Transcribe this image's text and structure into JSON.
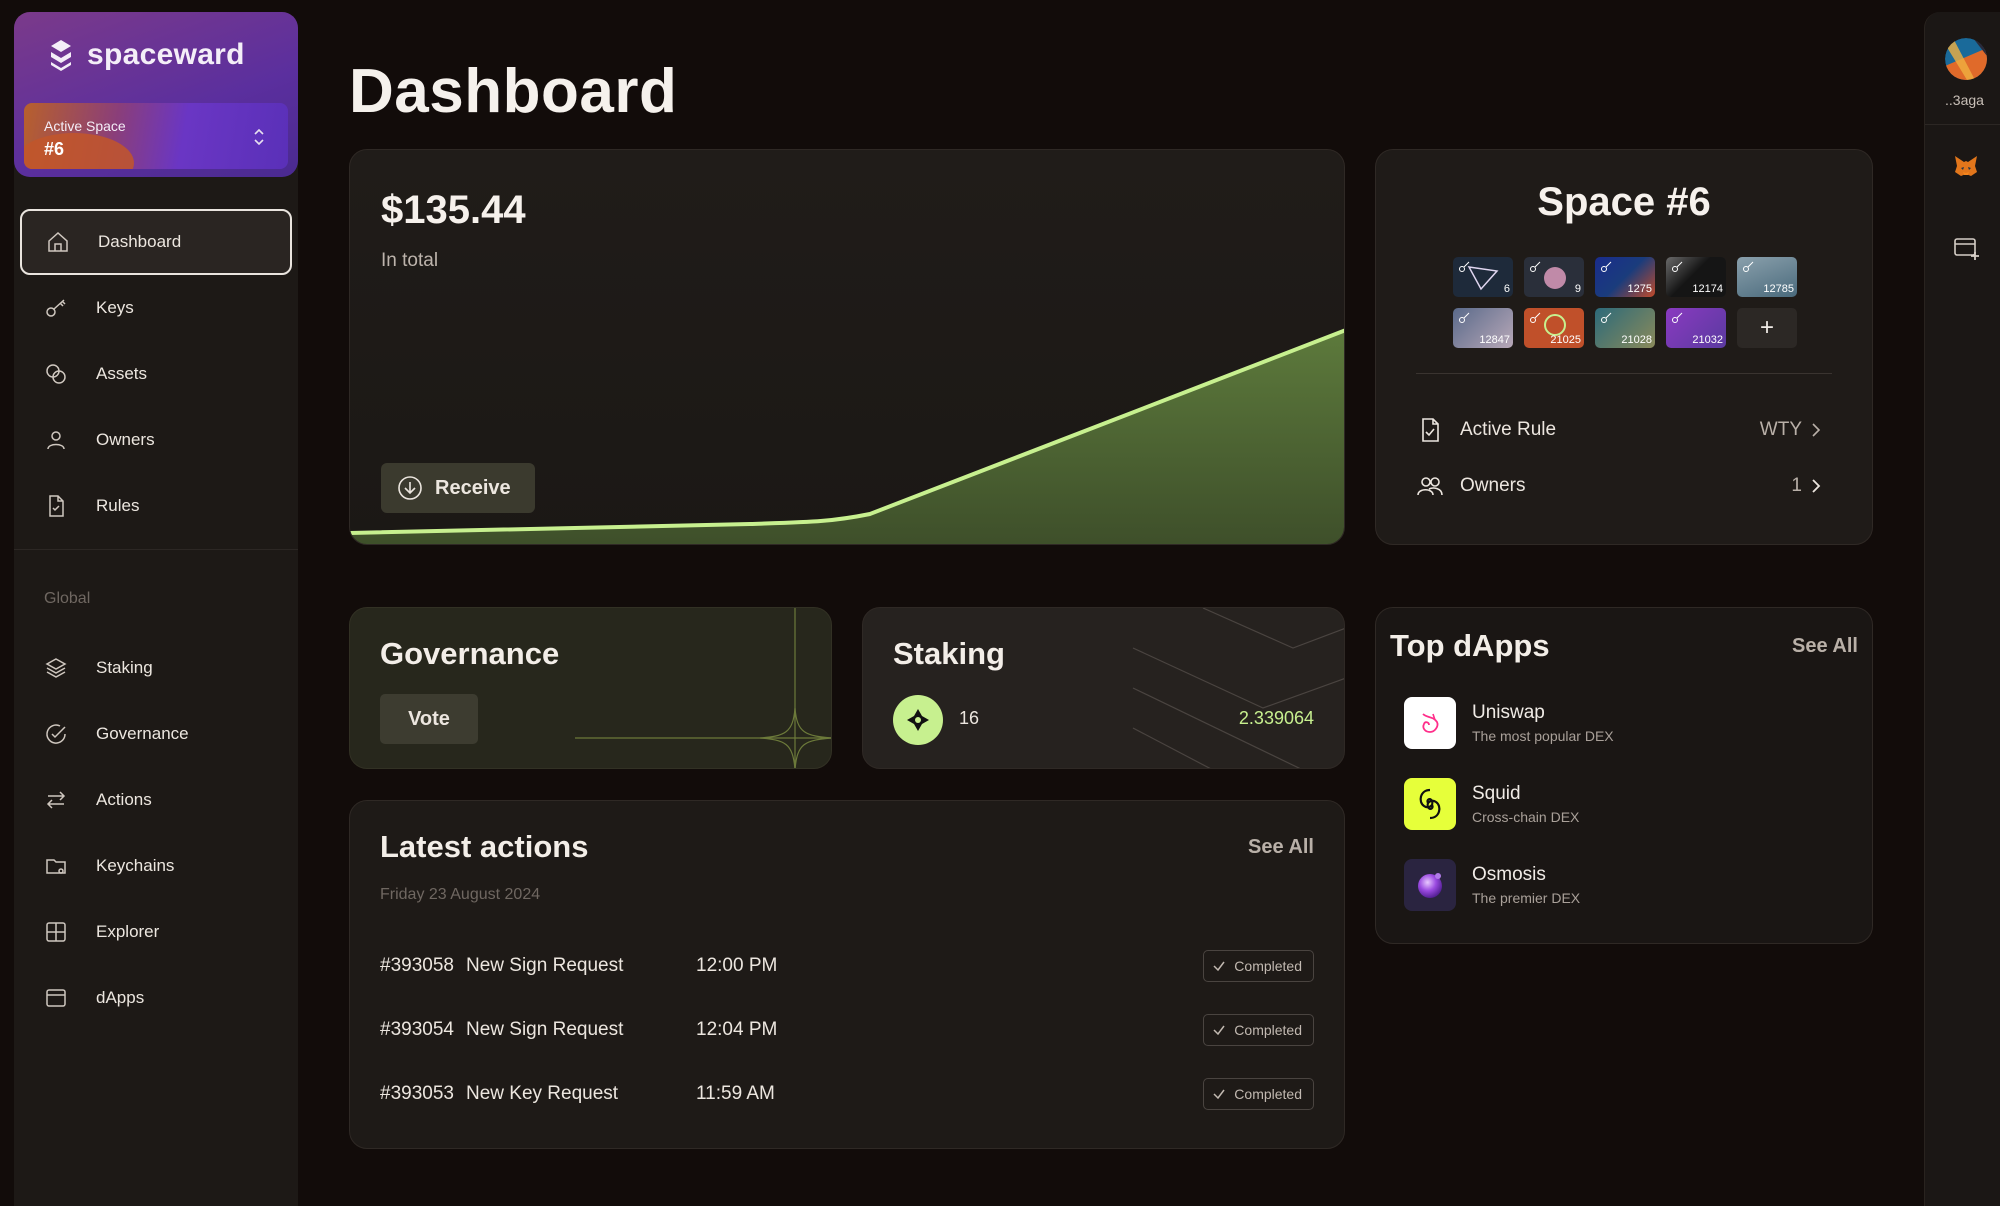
{
  "brand": {
    "name": "spaceward"
  },
  "space_selector": {
    "label": "Active Space",
    "value": "#6"
  },
  "nav": {
    "items": [
      {
        "label": "Dashboard",
        "icon": "home-icon",
        "active": true
      },
      {
        "label": "Keys",
        "icon": "key-icon"
      },
      {
        "label": "Assets",
        "icon": "coins-icon"
      },
      {
        "label": "Owners",
        "icon": "user-icon"
      },
      {
        "label": "Rules",
        "icon": "file-icon"
      }
    ],
    "global_heading": "Global",
    "global_items": [
      {
        "label": "Staking",
        "icon": "layers-icon"
      },
      {
        "label": "Governance",
        "icon": "check-circle-icon"
      },
      {
        "label": "Actions",
        "icon": "arrows-icon"
      },
      {
        "label": "Keychains",
        "icon": "folder-icon"
      },
      {
        "label": "Explorer",
        "icon": "grid-icon"
      },
      {
        "label": "dApps",
        "icon": "browser-icon"
      }
    ]
  },
  "page_title": "Dashboard",
  "balance": {
    "amount": "$135.44",
    "label": "In total",
    "receive_label": "Receive",
    "accent": "#c7f08f"
  },
  "space": {
    "title": "Space #6",
    "keys": [
      {
        "num": "6",
        "bg": "#2a3a4a"
      },
      {
        "num": "9",
        "bg": "#3a4a5a"
      },
      {
        "num": "1275",
        "bg": "#1a3c7c"
      },
      {
        "num": "12174",
        "bg": "#151515"
      },
      {
        "num": "12785",
        "bg": "#6a8a9c"
      },
      {
        "num": "12847",
        "bg": "#8a7c8c"
      },
      {
        "num": "21025",
        "bg": "#c0502a"
      },
      {
        "num": "21028",
        "bg": "#2c6a7a"
      },
      {
        "num": "21032",
        "bg": "#6a3ab0"
      }
    ],
    "add_label": "+",
    "active_rule_label": "Active Rule",
    "active_rule_value": "WTY",
    "owners_label": "Owners",
    "owners_value": "1"
  },
  "governance": {
    "title": "Governance",
    "vote_label": "Vote"
  },
  "staking": {
    "title": "Staking",
    "count": "16",
    "value": "2.339064"
  },
  "latest_actions": {
    "title": "Latest actions",
    "see_all": "See All",
    "date": "Friday 23 August 2024",
    "rows": [
      {
        "id": "#393058",
        "desc": "New Sign Request",
        "time": "12:00 PM",
        "status": "Completed"
      },
      {
        "id": "#393054",
        "desc": "New Sign Request",
        "time": "12:04 PM",
        "status": "Completed"
      },
      {
        "id": "#393053",
        "desc": "New Key Request",
        "time": "11:59 AM",
        "status": "Completed"
      }
    ]
  },
  "top_dapps": {
    "title": "Top dApps",
    "see_all": "See All",
    "items": [
      {
        "name": "Uniswap",
        "desc": "The most popular DEX",
        "bg": "#ffffff"
      },
      {
        "name": "Squid",
        "desc": "Cross-chain DEX",
        "bg": "#e6ff3a"
      },
      {
        "name": "Osmosis",
        "desc": "The premier DEX",
        "bg": "#2a2440"
      }
    ]
  },
  "rail": {
    "account_name": "..3aga"
  }
}
